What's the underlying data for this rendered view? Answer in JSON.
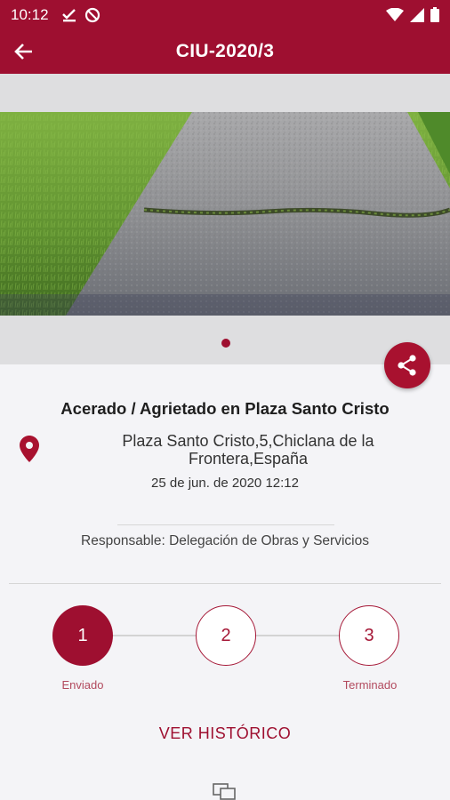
{
  "status_bar": {
    "time": "10:12"
  },
  "app_bar": {
    "title": "CIU-2020/3"
  },
  "incident": {
    "title": "Acerado / Agrietado en Plaza Santo Cristo",
    "address": "Plaza Santo Cristo,5,Chiclana de la Frontera,España",
    "date": "25 de jun. de 2020 12:12",
    "responsible": "Responsable: Delegación de Obras y Servicios"
  },
  "steps": [
    {
      "number": "1",
      "label": "Enviado",
      "state": "active"
    },
    {
      "number": "2",
      "label": "",
      "state": "pending"
    },
    {
      "number": "3",
      "label": "Terminado",
      "state": "pending"
    }
  ],
  "history_button": "VER HISTÓRICO",
  "colors": {
    "primary": "#9e0f30",
    "background": "#f4f4f7"
  },
  "icons": [
    "back-arrow-icon",
    "share-icon",
    "location-pin-icon",
    "map-icon"
  ]
}
